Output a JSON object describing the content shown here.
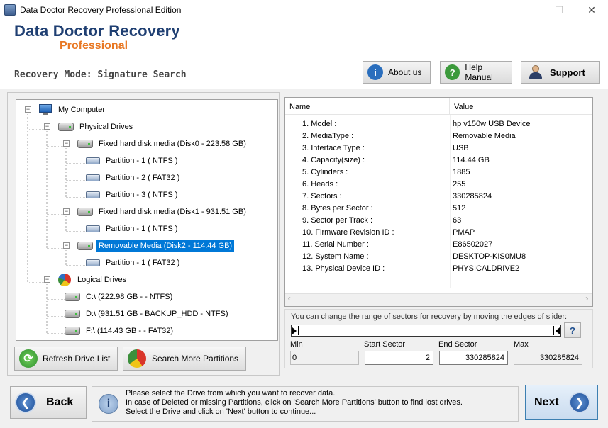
{
  "window": {
    "title": "Data Doctor Recovery Professional Edition",
    "minimize": "—",
    "maximize": "☐",
    "close": "✕"
  },
  "header": {
    "brand_title": "Data Doctor Recovery",
    "brand_subtitle": "Professional",
    "mode": "Recovery Mode: Signature Search",
    "about_label": "About us",
    "help_label": "Help Manual",
    "support_label": "Support"
  },
  "tree": {
    "items": [
      {
        "label": "My Computer",
        "icon": "computer-icon"
      },
      {
        "label": "Physical Drives",
        "icon": "drive-icon"
      },
      {
        "label": "Fixed hard disk media (Disk0 - 223.58 GB)",
        "icon": "drive-icon"
      },
      {
        "label": "Partition - 1 ( NTFS )",
        "icon": "partition-icon"
      },
      {
        "label": "Partition - 2 ( FAT32 )",
        "icon": "partition-icon"
      },
      {
        "label": "Partition - 3 ( NTFS )",
        "icon": "partition-icon"
      },
      {
        "label": "Fixed hard disk media (Disk1 - 931.51 GB)",
        "icon": "drive-icon"
      },
      {
        "label": "Partition - 1 ( NTFS )",
        "icon": "partition-icon"
      },
      {
        "label": "Removable Media (Disk2 - 114.44 GB)",
        "icon": "drive-icon",
        "selected": true
      },
      {
        "label": "Partition - 1 ( FAT32 )",
        "icon": "partition-icon"
      },
      {
        "label": "Logical Drives",
        "icon": "pie-icon"
      },
      {
        "label": "C:\\ (222.98 GB -  - NTFS)",
        "icon": "drive-icon"
      },
      {
        "label": "D:\\ (931.51 GB - BACKUP_HDD - NTFS)",
        "icon": "drive-icon"
      },
      {
        "label": "F:\\ (114.43 GB -  - FAT32)",
        "icon": "drive-icon"
      }
    ]
  },
  "details": {
    "col_name": "Name",
    "col_value": "Value",
    "rows": [
      {
        "name": "1. Model :",
        "value": "hp v150w USB Device"
      },
      {
        "name": "2. MediaType :",
        "value": "Removable Media"
      },
      {
        "name": "3. Interface Type :",
        "value": "USB"
      },
      {
        "name": "4. Capacity(size) :",
        "value": "114.44 GB"
      },
      {
        "name": "5. Cylinders :",
        "value": "1885"
      },
      {
        "name": "6. Heads :",
        "value": "255"
      },
      {
        "name": "7. Sectors :",
        "value": "330285824"
      },
      {
        "name": "8. Bytes per Sector :",
        "value": "512"
      },
      {
        "name": "9. Sector per Track :",
        "value": "63"
      },
      {
        "name": "10. Firmware Revision ID :",
        "value": "PMAP"
      },
      {
        "name": "11. Serial Number :",
        "value": "E86502027"
      },
      {
        "name": "12. System Name :",
        "value": "DESKTOP-KIS0MU8"
      },
      {
        "name": "13. Physical Device ID :",
        "value": "PHYSICALDRIVE2"
      }
    ]
  },
  "sector_range": {
    "hint": "You can change the range of sectors for recovery by moving the edges of slider:",
    "help": "?",
    "min_label": "Min",
    "min_value": "0",
    "start_label": "Start Sector",
    "start_value": "2",
    "end_label": "End Sector",
    "end_value": "330285824",
    "max_label": "Max",
    "max_value": "330285824"
  },
  "actions": {
    "refresh_label": "Refresh Drive List",
    "search_label": "Search More Partitions",
    "back_label": "Back",
    "next_label": "Next"
  },
  "info": {
    "line1": "Please select the Drive from which you want to recover data.",
    "line2": "In case of Deleted or missing Partitions, click on 'Search More Partitions' button to find lost drives.",
    "line3": "Select the Drive and click on 'Next' button to continue..."
  },
  "colors": {
    "brand": "#1f3f72",
    "accent": "#e87722",
    "selection": "#0078d7"
  }
}
